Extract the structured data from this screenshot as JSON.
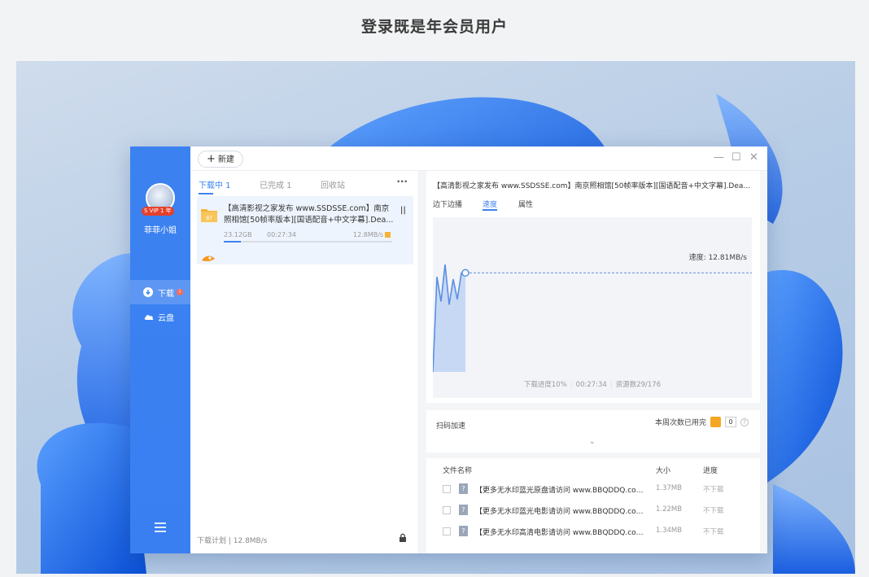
{
  "heading": "登录既是年会员用户",
  "sidebar": {
    "vip_badge": "S VIP 1 年",
    "username": "菲菲小姐",
    "nav": [
      {
        "label": "下载",
        "badge": "!"
      },
      {
        "label": "云盘"
      }
    ]
  },
  "toolbar": {
    "new_label": "新建",
    "controls": [
      "—",
      "☐",
      "✕"
    ]
  },
  "tabs": {
    "downloading": "下载中 1",
    "completed": "已完成 1",
    "recycle": "回收站",
    "more": "···"
  },
  "download_item": {
    "title": "【高清影视之家发布 www.SSDSSE.com】南京照相馆[50帧率版本][国语配音+中文字幕].Dea...",
    "size": "23.12GB",
    "time": "00:27:34",
    "speed": "12.8MB/s",
    "progress_percent": 10,
    "pause": "||"
  },
  "footer": {
    "plan": "下载计划 | 12.8MB/s"
  },
  "detail": {
    "title": "【高清影视之家发布 www.SSDSSE.com】南京照相馆[50帧率版本][国语配音+中文字幕].Dead.to...",
    "tabs": [
      "边下边播",
      "速度",
      "属性"
    ],
    "speed_label": "速度: 12.81MB/s",
    "progress_text": "下载进度10%",
    "elapsed": "00:27:34",
    "resources": "资源数29/176"
  },
  "accel": {
    "label": "扫码加速",
    "used_label": "本周次数已用完",
    "count": "0",
    "help": "?",
    "chevron": "⌄"
  },
  "files": {
    "headers": {
      "name": "文件名称",
      "size": "大小",
      "progress": "进度"
    },
    "rows": [
      {
        "name": "【更多无水印蓝光原盘请访问 www.BBQDDQ.com】...",
        "size": "1.37MB",
        "progress": "不下载"
      },
      {
        "name": "【更多无水印蓝光电影请访问 www.BBQDDQ.com】...",
        "size": "1.22MB",
        "progress": "不下载"
      },
      {
        "name": "【更多无水印高清电影请访问 www.BBQDDQ.com】...",
        "size": "1.34MB",
        "progress": "不下载"
      }
    ]
  },
  "chart_data": {
    "type": "area",
    "series": [
      {
        "values": [
          0,
          12.3,
          9.1,
          13.9,
          8.7,
          12.0,
          9.4,
          12.8,
          12.81
        ]
      }
    ],
    "ylabel": "",
    "xlabel": ""
  },
  "colors": {
    "accent": "#3b82f0",
    "sidebar": "#3a7ff2",
    "badge": "#e6412c"
  }
}
